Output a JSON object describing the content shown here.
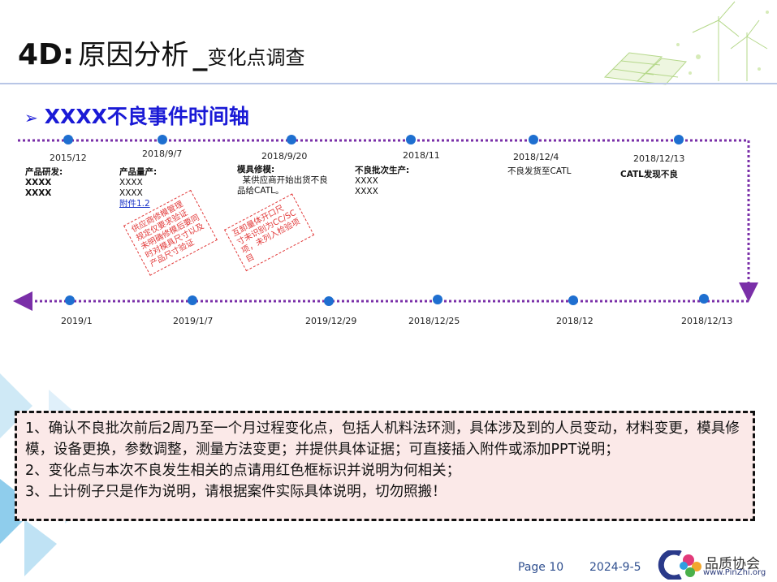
{
  "header": {
    "title_prefix": "4D:",
    "title_main": "原因分析",
    "title_sep": "_",
    "title_sub": "变化点调查"
  },
  "section": {
    "heading": "XXXX不良事件时间轴"
  },
  "timeline_top": [
    {
      "date": "2015/12",
      "head": "产品研发:",
      "lines": [
        "XXXX",
        "XXXX"
      ],
      "bold_lines": true
    },
    {
      "date": "2018/9/7",
      "head": "产品量产:",
      "lines": [
        "XXXX",
        "XXXX"
      ],
      "link": "附件1.2"
    },
    {
      "date": "2018/9/20",
      "head": "模具修模:",
      "lines": [
        "  某供应商开始出货不良",
        "品给CATL。"
      ]
    },
    {
      "date": "2018/11",
      "head": "不良批次生产:",
      "lines": [
        "XXXX",
        "XXXX"
      ]
    },
    {
      "date": "2018/12/4",
      "text": "不良发货至CATL"
    },
    {
      "date": "2018/12/13",
      "head": "CATL发现不良"
    }
  ],
  "timeline_bottom": [
    {
      "date": "2019/1"
    },
    {
      "date": "2019/1/7"
    },
    {
      "date": "2019/12/29"
    },
    {
      "date": "2018/12/25"
    },
    {
      "date": "2018/12"
    },
    {
      "date": "2018/12/13"
    }
  ],
  "red_notes": [
    {
      "lines": [
        "供应商修模管理",
        "规定仅要求验证",
        "未明确修模后要同",
        "时对模具尺寸以及",
        "产品尺寸验证"
      ]
    },
    {
      "lines": [
        "互卸量体开口尺",
        "寸未识别为CC/SC",
        "项，未列入检验项",
        "目"
      ]
    }
  ],
  "notes": [
    "1、确认不良批次前后2周乃至一个月过程变化点，包括人机料法环测，具体涉及到的人员变动，材料变更，模具修模，设备更换，参数调整，测量方法变更；并提供具体证据；可直接插入附件或添加PPT说明；",
    "2、变化点与本次不良发生相关的点请用红色框标识并说明为何相关；",
    "3、上计例子只是作为说明，请根据案件实际具体说明，切勿照搬！"
  ],
  "footer": {
    "page": "Page 10",
    "date": "2024-9-5",
    "logo_text": "品质协会",
    "logo_url": "www.PinZhi.org"
  },
  "colors": {
    "accent_blue": "#1a1ad6",
    "timeline_line": "#7a2fa8",
    "timeline_dot": "#1e6fd0",
    "red": "#e23a3a",
    "notes_bg": "#fbe9e8"
  }
}
